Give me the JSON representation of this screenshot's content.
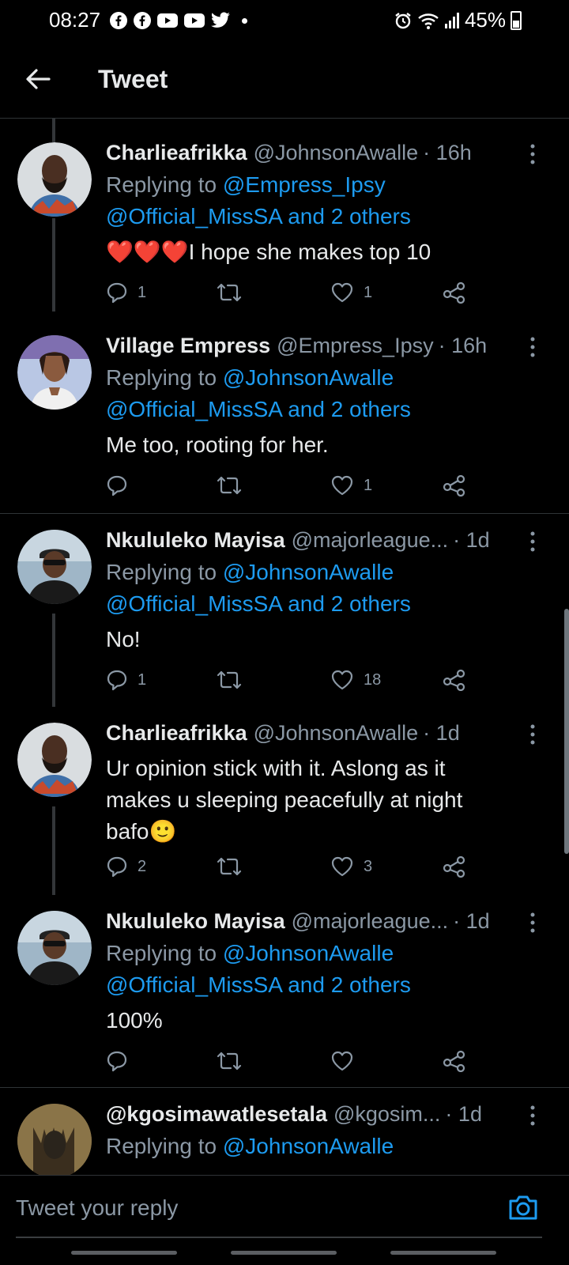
{
  "status_bar": {
    "time": "08:27",
    "battery": "45%"
  },
  "header": {
    "title": "Tweet"
  },
  "tweets": [
    {
      "name": "Charlieafrikka",
      "handle": "@JohnsonAwalle",
      "sep": "·",
      "time": "16h",
      "reply_prefix": "Replying to",
      "reply_first": "@Empress_Ipsy",
      "reply_rest": "@Official_MissSA and 2 others",
      "text": "I hope she makes top 10",
      "hearts": "❤️❤️❤️",
      "replies": "1",
      "retweets": "",
      "likes": "1"
    },
    {
      "name": "Village Empress",
      "handle": "@Empress_Ipsy",
      "sep": "·",
      "time": "16h",
      "reply_prefix": "Replying to",
      "reply_first": "@JohnsonAwalle",
      "reply_rest": "@Official_MissSA and 2 others",
      "text": "Me too, rooting for her.",
      "replies": "",
      "retweets": "",
      "likes": "1"
    },
    {
      "name": "Nkululeko Mayisa",
      "handle": "@majorleague...",
      "sep": "·",
      "time": "1d",
      "reply_prefix": "Replying to",
      "reply_first": "@JohnsonAwalle",
      "reply_rest": "@Official_MissSA and 2 others",
      "text": "No!",
      "replies": "1",
      "retweets": "",
      "likes": "18"
    },
    {
      "name": "Charlieafrikka",
      "handle": "@JohnsonAwalle",
      "sep": "·",
      "time": "1d",
      "text_line1": "Ur opinion stick with it. Aslong  as it",
      "text_line2": "makes u sleeping peacefully at night",
      "text_line3": "bafo",
      "emoji": "🙂",
      "replies": "2",
      "retweets": "",
      "likes": "3"
    },
    {
      "name": "Nkululeko Mayisa",
      "handle": "@majorleague...",
      "sep": "·",
      "time": "1d",
      "reply_prefix": "Replying to",
      "reply_first": "@JohnsonAwalle",
      "reply_rest": "@Official_MissSA and 2 others",
      "text": "100%",
      "replies": "",
      "retweets": "",
      "likes": ""
    },
    {
      "name": "@kgosimawatlesetala",
      "handle": "@kgosim...",
      "sep": "·",
      "time": "1d",
      "reply_prefix": "Replying to",
      "reply_first": "@JohnsonAwalle"
    }
  ],
  "composer": {
    "placeholder": "Tweet your reply"
  },
  "colors": {
    "accent": "#1d9bf0",
    "muted": "#8b98a5",
    "background": "#000000",
    "divider": "#2f3336"
  },
  "icons": {
    "back": "arrow-left-icon",
    "more": "more-vertical-icon",
    "reply": "comment-icon",
    "retweet": "retweet-icon",
    "like": "heart-icon",
    "share": "share-icon",
    "camera": "camera-icon"
  }
}
